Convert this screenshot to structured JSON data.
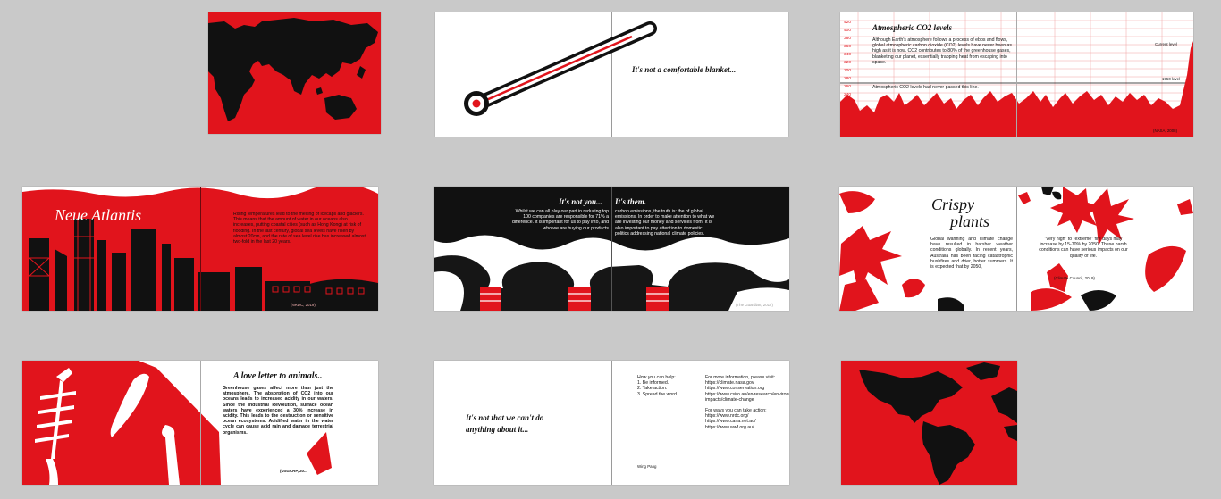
{
  "colors": {
    "red": "#e1141c",
    "black": "#111111",
    "canvas": "#c9c9c9"
  },
  "thermometer": {
    "caption": "It's not a comfortable blanket..."
  },
  "co2": {
    "title": "Atmospheric CO2 levels",
    "body": "Although Earth's atmosphere follows a process of ebbs and flows, global atmospheric carbon dioxide (CO2) levels have never been as high as it is now. CO2 contributes to 80% of the greenhouse gases, blanketing our planet, essentially trapping heat from escaping into space.",
    "body2": "Atmospheric CO2 levels had never passed this line.",
    "current_label": "Current level",
    "level1950_label": "1950 level",
    "source": "(NASA, 2008)",
    "axis_ticks": [
      "420",
      "400",
      "380",
      "360",
      "340",
      "320",
      "300",
      "280",
      "260",
      "240"
    ]
  },
  "atlantis": {
    "title": "Neue Atlantis",
    "body": "Rising temperatures lead to the melting of icecaps and glaciers. This means that the amount of water in our oceans also increases, putting coastal cities (such as Hong Kong) at risk of flooding. In the last century, global sea levels have risen by almost 20cm, and the rate of sea level rise has increased almost two-fold in the last 20 years.",
    "source": "(NRDC, 2019)"
  },
  "them": {
    "heading_left": "It's not you...",
    "heading_right": "It's them.",
    "body_left": "Whilst we can all play our part in reducing top 100 companies are responsible for 71% a difference. It is important for us to pay into, and who we are buying our products",
    "body_right": "carbon emissions, the truth is: the of global emissions. In order to make attention to what we are investing our money and services from. It is also important to pay attention to domestic politics addressing national climate policies.",
    "source": "(The Guardian, 2017)"
  },
  "crispy": {
    "title_line1": "Crispy",
    "title_line2": "plants",
    "body": "Global warming and climate change have resulted in harsher weather conditions globally. In recent years, Australia has been facing catastrophic bushfires and drier, hotter summers. It is expected that by 2050,",
    "body_right": "\"very high\" to \"extreme\" fire days may increase by 15-70% by 2050. These harsh conditions can have serious impacts on our quality of life.",
    "source": "(Climate Council, 2019)"
  },
  "letter": {
    "title": "A love letter to animals..",
    "body": "Greenhouse gases affect more than just the atmosphere. The absorption of CO2 into our oceans leads to increased acidity in our waters. Since the Industrial Revolution, surface ocean waters have experienced a 30% increase in acidity. This leads to the destruction or sensitive ocean ecosystems. Acidified water in the water cycle can cause acid rain and damage terrestrial organisms.",
    "source": "(USGCRP, 20..."
  },
  "help": {
    "caption": "It's not that we can't do anything about it...",
    "heading": "How you can help:",
    "steps": [
      "1. Be informed.",
      "2. Take action.",
      "3. Spread the word."
    ],
    "info_heading": "For more information, please visit:",
    "links": [
      "https://climate.nasa.gov",
      "https://www.conservation.org",
      "https://www.csiro.au/en/research/environmental-impacts/climate-change"
    ],
    "action_heading": "For ways you can take action:",
    "action_links": [
      "https://www.nrdc.org/",
      "https://www.cana.net.au/",
      "https://www.wwf.org.au/"
    ],
    "author": "Wing Pang"
  }
}
